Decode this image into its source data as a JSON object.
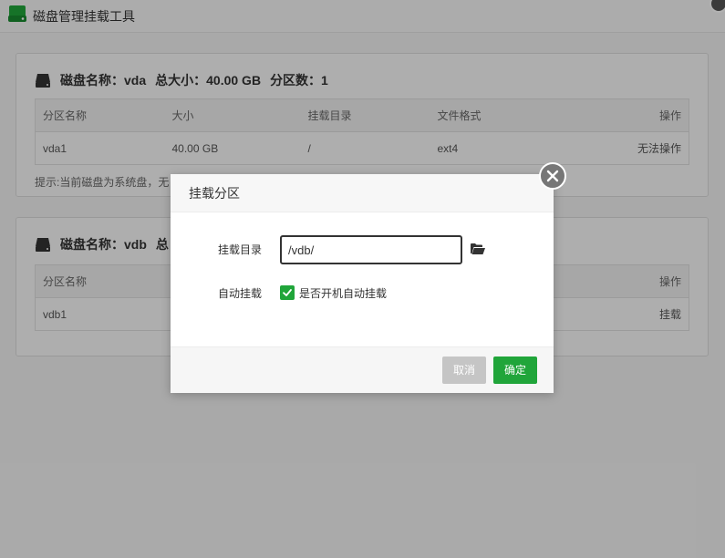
{
  "app": {
    "title": "磁盘管理挂载工具"
  },
  "table_headers": [
    "分区名称",
    "大小",
    "挂载目录",
    "文件格式",
    "操作"
  ],
  "disks": [
    {
      "label_name": "磁盘名称：vda",
      "label_size": "总大小：40.00 GB",
      "label_parts": "分区数：1",
      "rows": [
        {
          "name": "vda1",
          "size": "40.00 GB",
          "mount": "/",
          "fs": "ext4",
          "action": "无法操作"
        }
      ],
      "hint": "提示:当前磁盘为系统盘，无"
    },
    {
      "label_name": "磁盘名称：vdb",
      "label_size": "总",
      "header_action": "操作",
      "rows": [
        {
          "name": "vdb1",
          "action": "挂载"
        }
      ]
    }
  ],
  "dialog": {
    "title": "挂载分区",
    "mount_dir_label": "挂载目录",
    "mount_dir_value": "/vdb/",
    "auto_mount_label": "自动挂载",
    "auto_mount_checked": true,
    "auto_mount_text": "是否开机自动挂载",
    "cancel_label": "取消",
    "confirm_label": "确定"
  },
  "colors": {
    "accent": "#20a53a",
    "cancel": "#c5c5c5"
  }
}
